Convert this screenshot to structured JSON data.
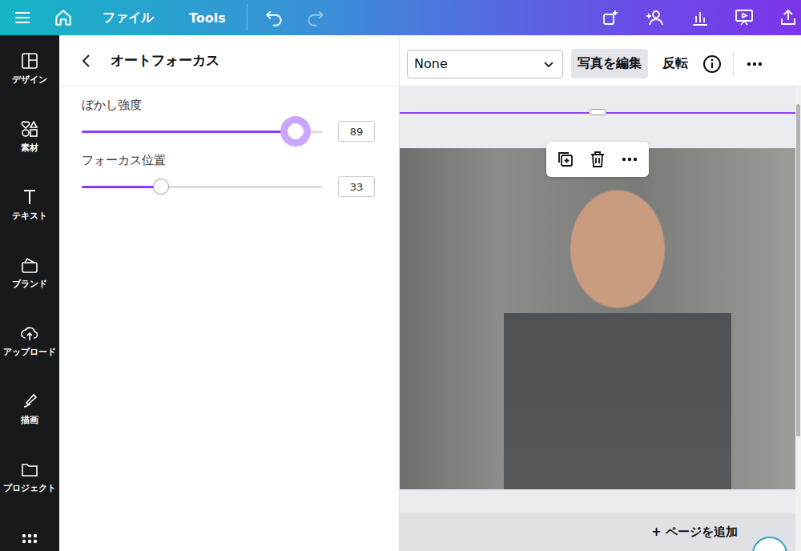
{
  "topbar": {
    "menus": [
      "ファイル",
      "Tools"
    ],
    "undo_disabled": false,
    "redo_disabled": true
  },
  "sidebar": {
    "items": [
      {
        "label": "デザイン"
      },
      {
        "label": "素材"
      },
      {
        "label": "テキスト"
      },
      {
        "label": "ブランド"
      },
      {
        "label": "アップロード"
      },
      {
        "label": "描画"
      },
      {
        "label": "プロジェクト"
      }
    ]
  },
  "panel": {
    "title": "オートフォーカス",
    "sliders": [
      {
        "label": "ぼかし強度",
        "level": 0.89,
        "value": "89",
        "focused": true
      },
      {
        "label": "フォーカス位置",
        "level": 0.33,
        "value": "33",
        "focused": false
      }
    ]
  },
  "toolbar": {
    "dropdown": "None",
    "buttons": [
      {
        "label": "写真を編集",
        "selected": true
      },
      {
        "label": "反転",
        "selected": false
      }
    ]
  },
  "canvas": {
    "image_selected": true
  },
  "add_page": "+ ページを追加"
}
